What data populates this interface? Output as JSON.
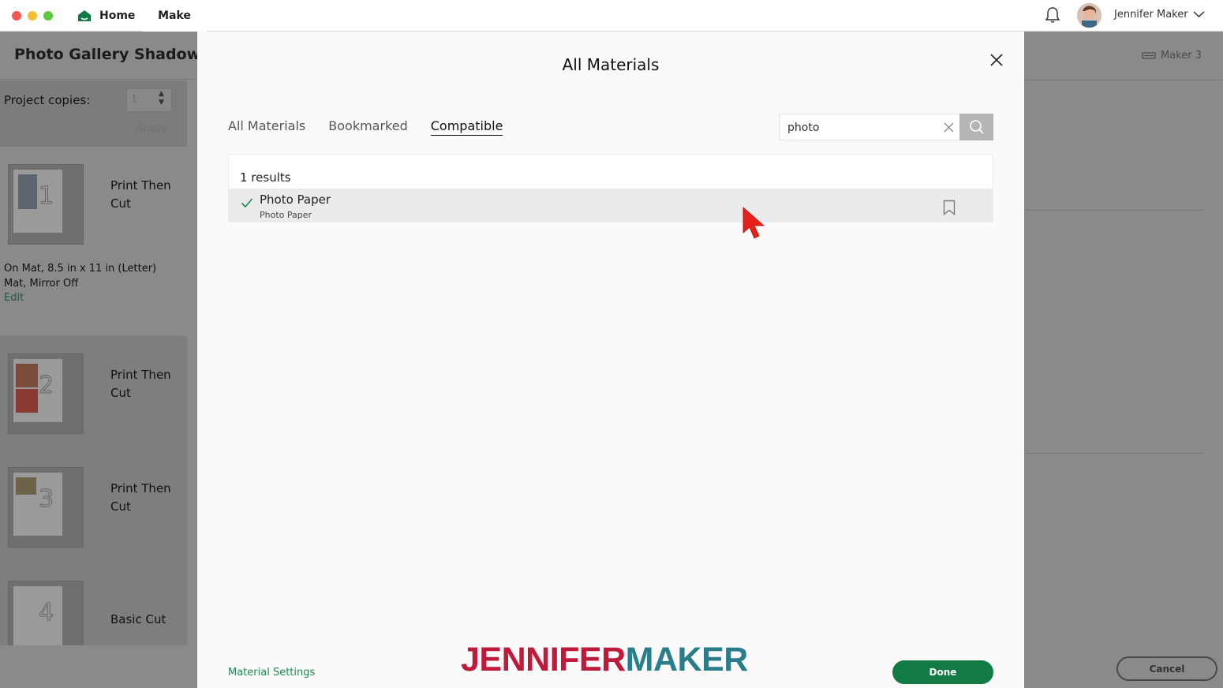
{
  "topbar": {
    "home_label": "Home",
    "make_label": "Make",
    "user_name": "Jennifer Maker"
  },
  "background": {
    "project_title": "Photo Gallery Shadow Box",
    "copies_label": "Project copies:",
    "copies_value": "1",
    "apply_label": "Apply",
    "mats": [
      {
        "number": "1",
        "label": "Print Then Cut"
      },
      {
        "number": "2",
        "label": "Print Then Cut"
      },
      {
        "number": "3",
        "label": "Print Then Cut"
      },
      {
        "number": "4",
        "label": "Basic Cut"
      }
    ],
    "mat_info": "On Mat, 8.5 in x 11 in (Letter) Mat, Mirror Off",
    "edit_label": "Edit",
    "machine_label": "Maker 3",
    "cancel_label": "Cancel"
  },
  "modal": {
    "title": "All Materials",
    "tabs": [
      {
        "label": "All Materials",
        "active": false
      },
      {
        "label": "Bookmarked",
        "active": false
      },
      {
        "label": "Compatible",
        "active": true
      }
    ],
    "search": {
      "value": "photo"
    },
    "results_count": "1 results",
    "results": [
      {
        "name": "Photo Paper",
        "category": "Photo Paper",
        "selected": true,
        "bookmarked": false
      }
    ],
    "footer": {
      "settings_label": "Material Settings",
      "done_label": "Done"
    }
  },
  "watermark": {
    "part1": "JENNIFER",
    "part2": "MAKER"
  },
  "colors": {
    "accent_green": "#127a44",
    "link_green": "#1e8a50",
    "watermark_red": "#c01a3a",
    "watermark_teal": "#2a7d8a"
  },
  "icons": [
    "house-icon",
    "bell-icon",
    "chevron-down-icon",
    "close-icon",
    "search-icon",
    "check-icon",
    "bookmark-icon",
    "machine-icon",
    "pointer-cursor-icon"
  ]
}
